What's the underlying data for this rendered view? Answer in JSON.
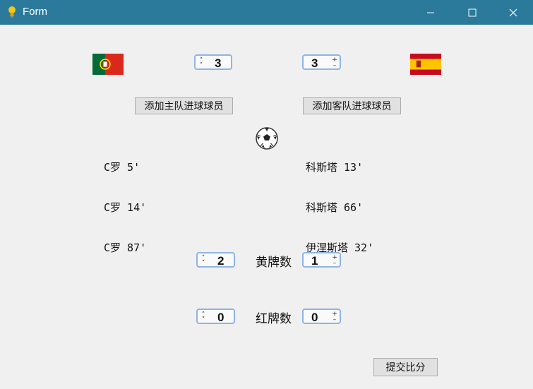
{
  "window": {
    "title": "Form"
  },
  "home": {
    "flag": "portugal-flag",
    "score": "3",
    "add_scorer_label": "添加主队进球球员",
    "scorers": [
      "C罗 5'",
      "C罗 14'",
      "C罗 87'"
    ],
    "yellow_cards": "2",
    "red_cards": "0"
  },
  "away": {
    "flag": "spain-flag",
    "score": "3",
    "add_scorer_label": "添加客队进球球员",
    "scorers": [
      "科斯塔 13'",
      "科斯塔 66'",
      "伊涅斯塔 32'"
    ],
    "yellow_cards": "1",
    "red_cards": "0"
  },
  "labels": {
    "yellow": "黄牌数",
    "red": "红牌数"
  },
  "submit_label": "提交比分",
  "icons": {
    "center": "soccer-ball-icon",
    "app": "lightbulb-icon"
  }
}
